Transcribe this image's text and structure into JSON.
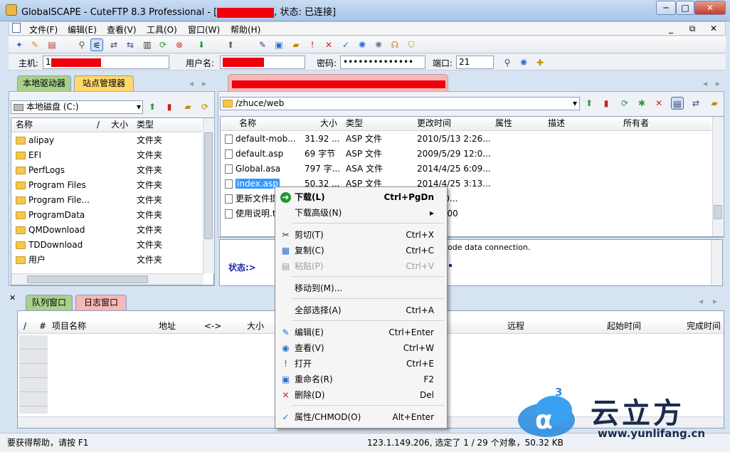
{
  "window": {
    "title_prefix": "GlobalSCAPE - CuteFTP 8.3 Professional - [",
    "title_suffix": ", 状态: 已连接]",
    "minimize": "0",
    "maximize": "1",
    "close": "r"
  },
  "menubar": {
    "items": [
      "文件(F)",
      "编辑(E)",
      "查看(V)",
      "工具(O)",
      "窗口(W)",
      "帮助(H)"
    ],
    "mdi_min": "_",
    "mdi_restore": "⧉",
    "mdi_close": "✕"
  },
  "connection": {
    "host_label": "主机:",
    "host_value": "1",
    "user_label": "用户名:",
    "user_value": "",
    "pass_label": "密码:",
    "pass_value": "••••••••••••••",
    "port_label": "端口:",
    "port_value": "21"
  },
  "left": {
    "tabs": [
      "本地驱动器",
      "站点管理器"
    ],
    "drive": "本地磁盘 (C:)",
    "columns": {
      "name": "名称",
      "slash": "/",
      "size": "大小",
      "type": "类型"
    },
    "rows": [
      {
        "name": "alipay",
        "type": "文件夹"
      },
      {
        "name": "EFI",
        "type": "文件夹"
      },
      {
        "name": "PerfLogs",
        "type": "文件夹"
      },
      {
        "name": "Program Files",
        "type": "文件夹"
      },
      {
        "name": "Program File...",
        "type": "文件夹"
      },
      {
        "name": "ProgramData",
        "type": "文件夹"
      },
      {
        "name": "QMDownload",
        "type": "文件夹"
      },
      {
        "name": "TDDownload",
        "type": "文件夹"
      },
      {
        "name": "用户",
        "type": "文件夹"
      }
    ]
  },
  "right": {
    "path": "/zhuce/web",
    "columns": {
      "name": "名称",
      "size": "大小",
      "type": "类型",
      "mtime": "更改时间",
      "attr": "属性",
      "desc": "描述",
      "owner": "所有者"
    },
    "rows": [
      {
        "name": "default-mob...",
        "size": "31.92 ...",
        "type": "ASP 文件",
        "mtime": "2010/5/13 2:26..."
      },
      {
        "name": "default.asp",
        "size": "69 字节",
        "type": "ASP 文件",
        "mtime": "2009/5/29 12:0..."
      },
      {
        "name": "Global.asa",
        "size": "797 字...",
        "type": "ASA 文件",
        "mtime": "2014/4/25 6:09..."
      },
      {
        "name": "index.asp",
        "size": "50.32 ...",
        "type": "ASP 文件",
        "mtime": "2014/4/25 3:13..."
      },
      {
        "name": "更新文件提...",
        "size": "",
        "type": "",
        "mtime": "30 12:0..."
      },
      {
        "name": "使用说明.t...",
        "size": "",
        "type": "",
        "mtime": "2 5:04:00"
      }
    ],
    "log_line": "ode data connection.",
    "status_label": "状态:>"
  },
  "queue": {
    "tabs": [
      "队列窗口",
      "日志窗口"
    ],
    "columns": {
      "slash": "/",
      "num": "#",
      "item": "项目名称",
      "addr": "地址",
      "arrow": "<->",
      "size": "大小",
      "remote": "远程",
      "start": "起始时间",
      "finish": "完成时间"
    }
  },
  "context_menu": {
    "items": [
      {
        "label": "下载(L)",
        "shortcut": "Ctrl+PgDn",
        "icon": "download-icon",
        "glyph": "➜",
        "bold": true
      },
      {
        "label": "下载高级(N)",
        "shortcut": "▸",
        "icon": "",
        "glyph": ""
      },
      {
        "label": "剪切(T)",
        "shortcut": "Ctrl+X",
        "icon": "scissors-icon",
        "glyph": "✂"
      },
      {
        "label": "复制(C)",
        "shortcut": "Ctrl+C",
        "icon": "copy-icon",
        "glyph": "▦"
      },
      {
        "label": "粘贴(P)",
        "shortcut": "Ctrl+V",
        "icon": "paste-icon",
        "glyph": "▤",
        "disabled": true
      },
      {
        "label": "移动到(M)...",
        "shortcut": "",
        "icon": "",
        "glyph": ""
      },
      {
        "label": "全部选择(A)",
        "shortcut": "Ctrl+A",
        "icon": "",
        "glyph": ""
      },
      {
        "label": "编辑(E)",
        "shortcut": "Ctrl+Enter",
        "icon": "edit-icon",
        "glyph": "✎"
      },
      {
        "label": "查看(V)",
        "shortcut": "Ctrl+W",
        "icon": "view-icon",
        "glyph": "◉"
      },
      {
        "label": "打开",
        "shortcut": "Ctrl+E",
        "icon": "open-icon",
        "glyph": "!"
      },
      {
        "label": "重命名(R)",
        "shortcut": "F2",
        "icon": "rename-icon",
        "glyph": "▣"
      },
      {
        "label": "删除(D)",
        "shortcut": "Del",
        "icon": "delete-icon",
        "glyph": "✕"
      },
      {
        "label": "属性/CHMOD(O)",
        "shortcut": "Alt+Enter",
        "icon": "properties-icon",
        "glyph": "✓"
      }
    ]
  },
  "statusbar": {
    "help": "要获得帮助，请按 F1",
    "selection": "123.1.149.206, 选定了 1 / 29 个对象，50.32 KB"
  },
  "watermark": {
    "brand": "云立方",
    "url": "www.yunlifang.cn",
    "sup": "3"
  },
  "colors": {
    "accent_tab": "#a8d08a",
    "site_tab": "#ffd96a",
    "log_tab": "#f7b7b7",
    "selection": "#3399ff",
    "redaction": "#f0000a"
  }
}
